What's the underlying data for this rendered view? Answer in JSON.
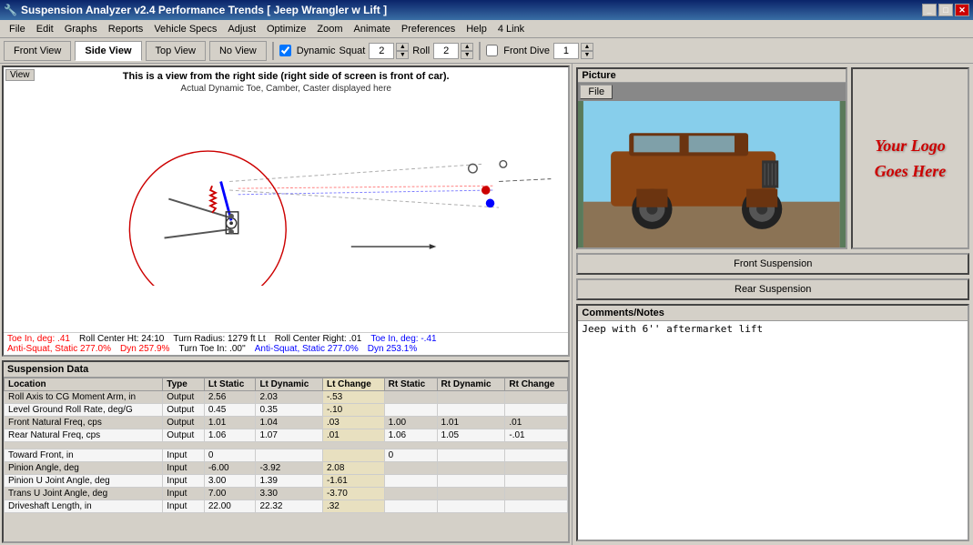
{
  "titlebar": {
    "title": "Suspension Analyzer v2.4   Performance Trends   [ Jeep Wrangler w Lift ]",
    "icon": "⚙"
  },
  "menubar": {
    "items": [
      "File",
      "Edit",
      "Graphs",
      "Reports",
      "Vehicle Specs",
      "Adjust",
      "Optimize",
      "Zoom",
      "Animate",
      "Preferences",
      "Help",
      "4 Link"
    ]
  },
  "toolbar": {
    "tabs": [
      "Front View",
      "Side View",
      "Top View",
      "No View"
    ],
    "active_tab": "Side View",
    "dynamic_label": "Dynamic",
    "squat_label": "Squat",
    "squat_value": "2",
    "roll_label": "Roll",
    "roll_value": "2",
    "front_dive_label": "Front Dive",
    "front_dive_value": "1"
  },
  "view": {
    "label": "View",
    "title": "This is a view from the right side (right side of screen is front of car).",
    "subtitle": "Actual Dynamic Toe, Camber, Caster displayed here"
  },
  "status": {
    "row1": [
      {
        "label": "Toe In, deg:",
        "value": ".41",
        "color": "red"
      },
      {
        "label": "Roll Center Ht:",
        "value": "24:10"
      },
      {
        "label": "Turn Radius:",
        "value": "1279 ft Lt"
      },
      {
        "label": "Roll Center Right:",
        "value": ".01"
      },
      {
        "label": "Toe In, deg: -.41",
        "color": "blue"
      }
    ],
    "row2": [
      {
        "label": "Anti-Squat, Static 277.0%",
        "color": "red"
      },
      {
        "label": "Dyn 257.9%",
        "color": "red"
      },
      {
        "label": "Turn Toe In:",
        "value": ".00''"
      },
      {
        "label": "Anti-Squat, Static 277.0%",
        "color": "blue"
      },
      {
        "label": "Dyn 253.1%",
        "color": "blue"
      }
    ]
  },
  "suspension_data": {
    "header": "Suspension Data",
    "columns": [
      "Location",
      "Type",
      "Lt Static",
      "Lt Dynamic",
      "Lt Change",
      "Rt Static",
      "Rt Dynamic",
      "Rt Change"
    ],
    "rows": [
      [
        "Roll Axis to CG Moment Arm, in",
        "Output",
        "2.56",
        "2.03",
        "-.53",
        "",
        "",
        ""
      ],
      [
        "Level Ground Roll Rate, deg/G",
        "Output",
        "0.45",
        "0.35",
        "-.10",
        "",
        "",
        ""
      ],
      [
        "Front Natural Freq, cps",
        "Output",
        "1.01",
        "1.04",
        ".03",
        "1.00",
        "1.01",
        ".01"
      ],
      [
        "Rear Natural Freq, cps",
        "Output",
        "1.06",
        "1.07",
        ".01",
        "1.06",
        "1.05",
        "-.01"
      ],
      [
        "",
        "",
        "",
        "",
        "",
        "",
        "",
        ""
      ],
      [
        "Toward Front, in",
        "Input",
        "0",
        "",
        "",
        "0",
        "",
        ""
      ],
      [
        "Pinion Angle, deg",
        "Input",
        "-6.00",
        "-3.92",
        "2.08",
        "",
        "",
        ""
      ],
      [
        "Pinion U Joint Angle, deg",
        "Input",
        "3.00",
        "1.39",
        "-1.61",
        "",
        "",
        ""
      ],
      [
        "Trans U Joint Angle, deg",
        "Input",
        "7.00",
        "3.30",
        "-3.70",
        "",
        "",
        ""
      ],
      [
        "Driveshaft Length, in",
        "Input",
        "22.00",
        "22.32",
        ".32",
        "",
        "",
        ""
      ]
    ]
  },
  "picture": {
    "label": "Picture",
    "file_btn": "File"
  },
  "logo": {
    "text": "Your Logo\nGoes Here"
  },
  "buttons": {
    "front_suspension": "Front Suspension",
    "rear_suspension": "Rear Suspension"
  },
  "comments": {
    "header": "Comments/Notes",
    "text": "Jeep with 6'' aftermarket lift"
  }
}
